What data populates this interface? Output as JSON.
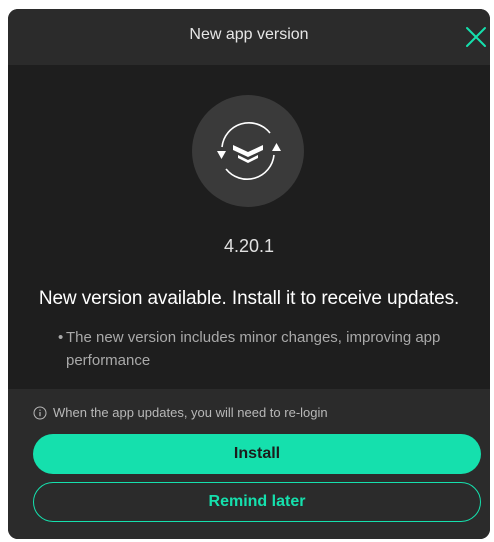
{
  "dialog": {
    "title": "New app version",
    "close_icon": "close-icon",
    "app_icon": "update-arrows-icon",
    "version": "4.20.1",
    "headline": "New version available. Install it to receive updates.",
    "bullets": [
      "The new version includes minor changes, improving app performance"
    ],
    "notice": "When the app updates, you will need to re-login",
    "notice_icon": "info-icon",
    "install_label": "Install",
    "remind_label": "Remind later"
  },
  "colors": {
    "accent": "#15e0ad",
    "background": "#1e1e1e",
    "panel": "#2b2b2b"
  }
}
